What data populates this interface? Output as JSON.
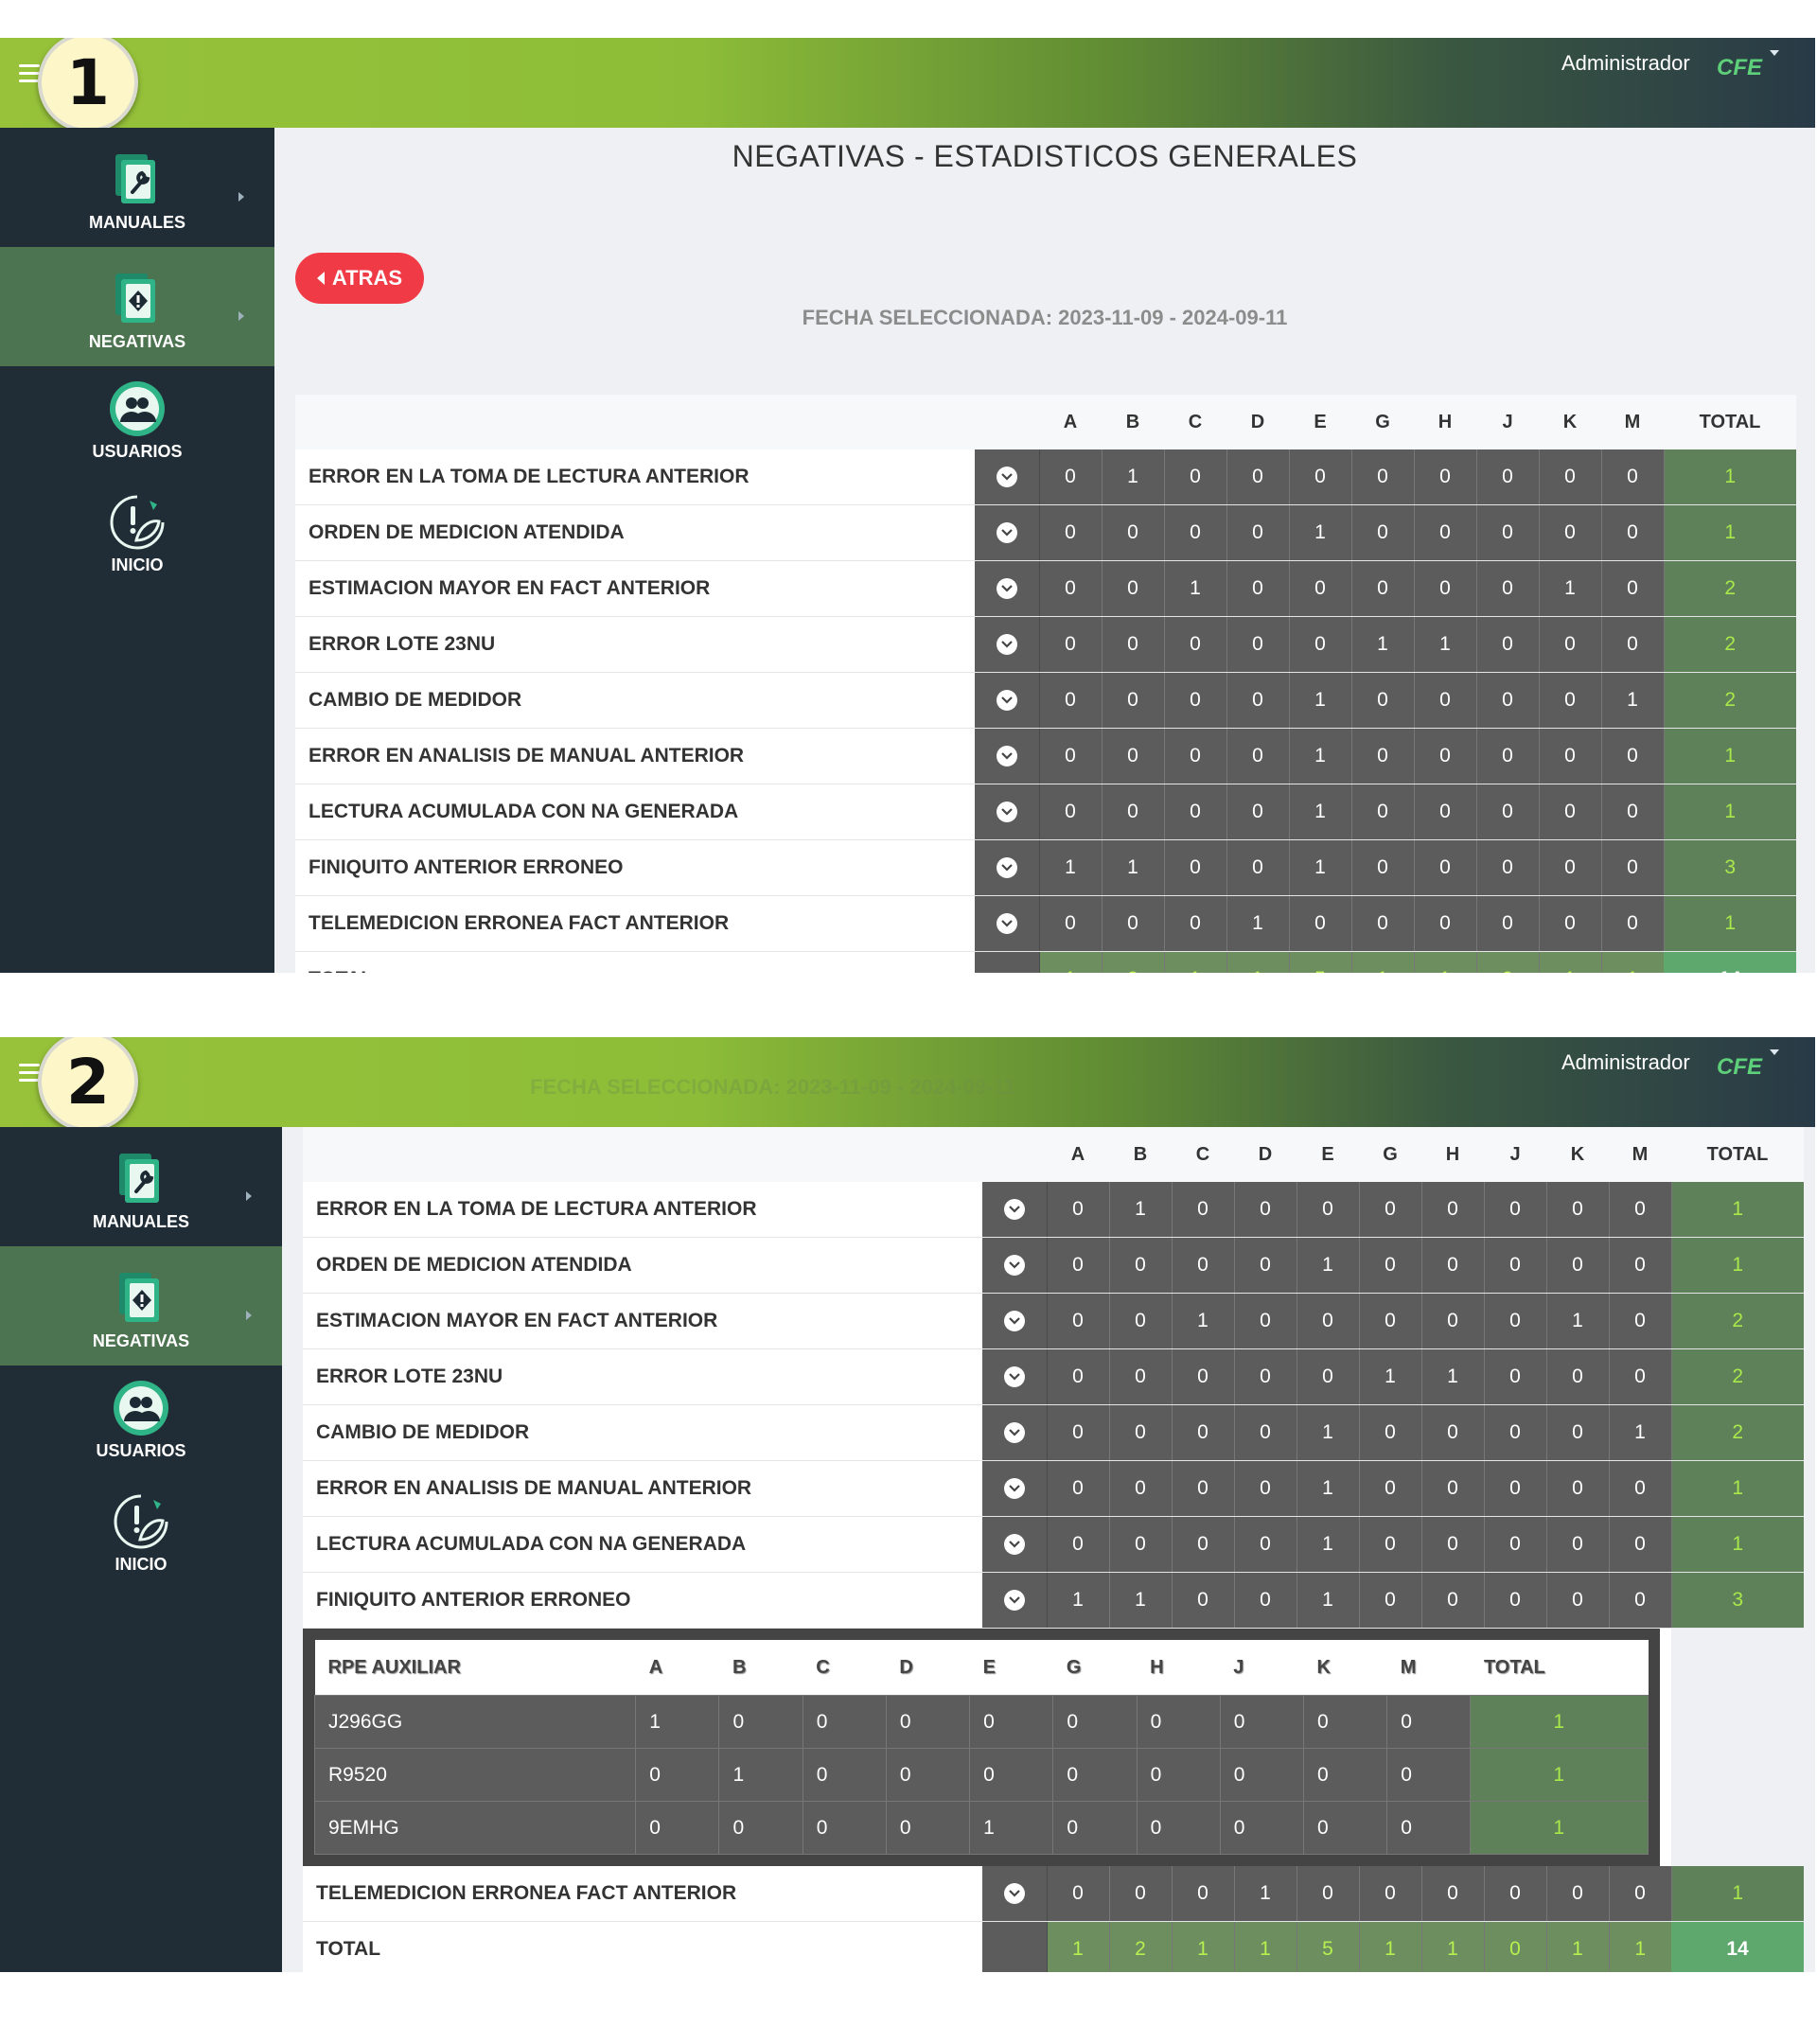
{
  "steps": [
    "1",
    "2"
  ],
  "header": {
    "user": "Administrador",
    "logo_text": "CFE"
  },
  "sidebar": {
    "items": [
      {
        "label": "MANUALES",
        "icon": "wrench-document-icon",
        "active": false,
        "has_submenu": true
      },
      {
        "label": "NEGATIVAS",
        "icon": "alert-document-icon",
        "active": true,
        "has_submenu": true
      },
      {
        "label": "USUARIOS",
        "icon": "users-icon",
        "active": false,
        "has_submenu": false
      },
      {
        "label": "INICIO",
        "icon": "leaf-alert-icon",
        "active": false,
        "has_submenu": false
      }
    ]
  },
  "page": {
    "title": "NEGATIVAS - ESTADISTICOS GENERALES",
    "back_label": "ATRAS",
    "date_label": "FECHA SELECCIONADA: 2023-11-09 - 2024-09-11"
  },
  "table": {
    "columns": [
      "A",
      "B",
      "C",
      "D",
      "E",
      "G",
      "H",
      "J",
      "K",
      "M",
      "TOTAL"
    ],
    "rows": [
      {
        "cause": "ERROR EN LA TOMA DE LECTURA ANTERIOR",
        "values": [
          "0",
          "1",
          "0",
          "0",
          "0",
          "0",
          "0",
          "0",
          "0",
          "0"
        ],
        "total": "1"
      },
      {
        "cause": "ORDEN DE MEDICION ATENDIDA",
        "values": [
          "0",
          "0",
          "0",
          "0",
          "1",
          "0",
          "0",
          "0",
          "0",
          "0"
        ],
        "total": "1"
      },
      {
        "cause": "ESTIMACION MAYOR EN FACT ANTERIOR",
        "values": [
          "0",
          "0",
          "1",
          "0",
          "0",
          "0",
          "0",
          "0",
          "1",
          "0"
        ],
        "total": "2"
      },
      {
        "cause": "ERROR LOTE 23NU",
        "values": [
          "0",
          "0",
          "0",
          "0",
          "0",
          "1",
          "1",
          "0",
          "0",
          "0"
        ],
        "total": "2"
      },
      {
        "cause": "CAMBIO DE MEDIDOR",
        "values": [
          "0",
          "0",
          "0",
          "0",
          "1",
          "0",
          "0",
          "0",
          "0",
          "1"
        ],
        "total": "2"
      },
      {
        "cause": "ERROR EN ANALISIS DE MANUAL ANTERIOR",
        "values": [
          "0",
          "0",
          "0",
          "0",
          "1",
          "0",
          "0",
          "0",
          "0",
          "0"
        ],
        "total": "1"
      },
      {
        "cause": "LECTURA ACUMULADA CON NA GENERADA",
        "values": [
          "0",
          "0",
          "0",
          "0",
          "1",
          "0",
          "0",
          "0",
          "0",
          "0"
        ],
        "total": "1"
      },
      {
        "cause": "FINIQUITO ANTERIOR ERRONEO",
        "values": [
          "1",
          "1",
          "0",
          "0",
          "1",
          "0",
          "0",
          "0",
          "0",
          "0"
        ],
        "total": "3"
      },
      {
        "cause": "TELEMEDICION ERRONEA FACT ANTERIOR",
        "values": [
          "0",
          "0",
          "0",
          "1",
          "0",
          "0",
          "0",
          "0",
          "0",
          "0"
        ],
        "total": "1"
      }
    ],
    "total_row": {
      "label": "TOTAL",
      "values": [
        "1",
        "2",
        "1",
        "1",
        "5",
        "1",
        "1",
        "0",
        "1",
        "1"
      ],
      "total": "14"
    }
  },
  "detail": {
    "expanded_row": 7,
    "columns": [
      "RPE AUXILIAR",
      "A",
      "B",
      "C",
      "D",
      "E",
      "G",
      "H",
      "J",
      "K",
      "M",
      "TOTAL"
    ],
    "rows": [
      {
        "rpe": "J296GG",
        "values": [
          "1",
          "0",
          "0",
          "0",
          "0",
          "0",
          "0",
          "0",
          "0",
          "0"
        ],
        "total": "1"
      },
      {
        "rpe": "R9520",
        "values": [
          "0",
          "1",
          "0",
          "0",
          "0",
          "0",
          "0",
          "0",
          "0",
          "0"
        ],
        "total": "1"
      },
      {
        "rpe": "9EMHG",
        "values": [
          "0",
          "0",
          "0",
          "0",
          "1",
          "0",
          "0",
          "0",
          "0",
          "0"
        ],
        "total": "1"
      }
    ]
  },
  "colors": {
    "accent_green": "#97c23a",
    "sidebar_bg": "#212d36",
    "sidebar_active": "#4d7450",
    "back_button": "#f03b46",
    "cell_bg": "#5c5c5c",
    "total_text": "#a8e84a"
  }
}
